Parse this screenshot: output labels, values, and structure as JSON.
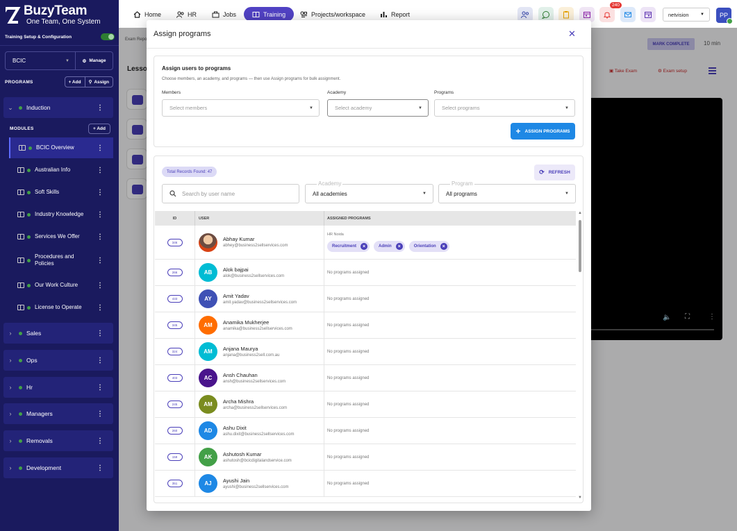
{
  "brand": {
    "title": "BuzyTeam",
    "tagline": "One Team, One System"
  },
  "sidebar": {
    "setup_label": "Training Setup & Configuration",
    "org": "BCIC",
    "manage": "Manage",
    "programs_label": "PROGRAMS",
    "add": "+ Add",
    "assign": "Assign",
    "modules_label": "MODULES",
    "modules_add": "+ Add",
    "programs": [
      "Induction",
      "Sales",
      "Ops",
      "Hr",
      "Managers",
      "Removals",
      "Development"
    ],
    "modules": [
      "BCIC Overview",
      "Australian Info",
      "Soft Skills",
      "Industry Knowledge",
      "Services We Offer",
      "Procedures and Policies",
      "Our Work Culture",
      "License to Operate"
    ]
  },
  "topnav": {
    "items": [
      "Home",
      "HR",
      "Jobs",
      "Training",
      "Projects/workspace",
      "Report"
    ],
    "notif_count": "240",
    "account": "netvision",
    "avatar": "PP"
  },
  "background": {
    "exam_text": "Exam Repo",
    "lesson_text": "Lesso",
    "mark_complete": "MARK COMPLETE",
    "duration": "10 min",
    "take_exam": "Take Exam",
    "exam_setup": "Exam setup"
  },
  "modal": {
    "title": "Assign programs",
    "section_title": "Assign users to programs",
    "section_sub": "Choose members, an academy, and programs — then use Assign programs for bulk assignment.",
    "members_label": "Members",
    "members_placeholder": "Select members",
    "academy_label": "Academy",
    "academy_placeholder": "Select academy",
    "programs_label": "Programs",
    "programs_placeholder": "Select programs",
    "assign_button": "ASSIGN PROGRAMS",
    "total_records": "Total Records Found: 47",
    "refresh_button": "REFRESH",
    "search_placeholder": "Search by user name",
    "academy_filter_label": "Academy",
    "academy_filter_value": "All academies",
    "program_filter_label": "Program",
    "program_filter_value": "All programs",
    "columns": {
      "id": "ID",
      "user": "USER",
      "programs": "ASSIGNED PROGRAMS"
    },
    "no_programs": "No programs assigned",
    "rows": [
      {
        "id": "346",
        "name": "Abhay Kumar",
        "email": "abhey@business2sellservices.com",
        "initials": "",
        "color": "#8d6e63",
        "academy": "HR Noida",
        "programs": [
          "Recruitment",
          "Admin",
          "Orientation"
        ]
      },
      {
        "id": "266",
        "name": "Alok bajpai",
        "email": "alok@business2sellservices.com",
        "initials": "AB",
        "color": "#00bcd4",
        "programs": []
      },
      {
        "id": "433",
        "name": "Amit Yadav",
        "email": "amit.yadav@business2sellservices.com",
        "initials": "AY",
        "color": "#3f51b5",
        "programs": []
      },
      {
        "id": "345",
        "name": "Anamika Mukherjee",
        "email": "anamika@business2sellservices.com",
        "initials": "AM",
        "color": "#ff6d00",
        "programs": []
      },
      {
        "id": "324",
        "name": "Anjana Maurya",
        "email": "anjana@business2sell.com.au",
        "initials": "AM",
        "color": "#00bcd4",
        "programs": []
      },
      {
        "id": "403",
        "name": "Ansh Chauhan",
        "email": "ansh@business2sellservices.com",
        "initials": "AC",
        "color": "#4a148c",
        "programs": []
      },
      {
        "id": "245",
        "name": "Archa Mishra",
        "email": "archa@business2sellservices.com",
        "initials": "AM",
        "color": "#7a8c1f",
        "programs": []
      },
      {
        "id": "260",
        "name": "Ashu Dixit",
        "email": "ashu.dixit@business2sellservices.com",
        "initials": "AD",
        "color": "#1e88e5",
        "programs": []
      },
      {
        "id": "159",
        "name": "Ashutosh Kumar",
        "email": "ashutosh@bcicdigitalandservice.com",
        "initials": "AK",
        "color": "#43a047",
        "programs": []
      },
      {
        "id": "351",
        "name": "Ayushi Jain",
        "email": "ayushi@business2sellservices.com",
        "initials": "AJ",
        "color": "#1e88e5",
        "programs": []
      }
    ]
  }
}
